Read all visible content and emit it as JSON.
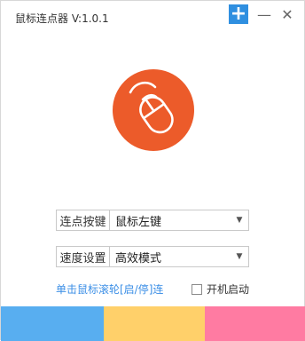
{
  "window": {
    "title": "鼠标连点器 V:1.0.1",
    "buttons": {
      "plus": "+",
      "minimize": "—",
      "close": "✕"
    }
  },
  "logo": {
    "color": "#ec5b2a",
    "icon": "mouse-icon"
  },
  "fields": [
    {
      "label": "连点按键",
      "value": "鼠标左键",
      "arrow": "▼"
    },
    {
      "label": "速度设置",
      "value": "高效模式",
      "arrow": "▼"
    }
  ],
  "hint": "单击鼠标滚轮[启/停]连",
  "startup": {
    "label": "开机启动",
    "checked": false
  },
  "color_bars": [
    "#58aef0",
    "#ffd06a",
    "#ff7ba2"
  ]
}
